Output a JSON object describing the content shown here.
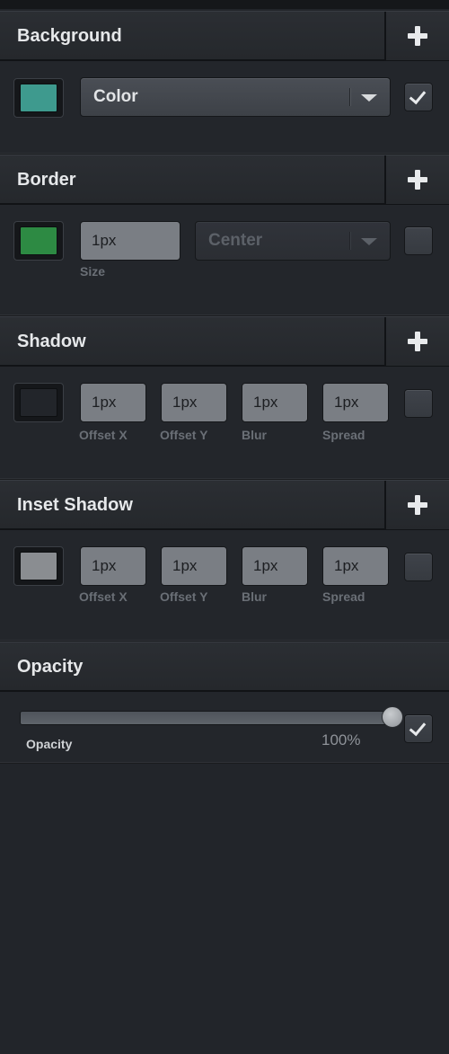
{
  "background": {
    "title": "Background",
    "swatch_color": "#3e9a8e",
    "dropdown_value": "Color",
    "enabled": true
  },
  "border": {
    "title": "Border",
    "swatch_color": "#2d8a43",
    "size_value": "1px",
    "size_label": "Size",
    "position_value": "Center",
    "enabled": false
  },
  "shadow": {
    "title": "Shadow",
    "swatch_color": "#22252a",
    "offset_x_value": "1px",
    "offset_y_value": "1px",
    "blur_value": "1px",
    "spread_value": "1px",
    "offset_x_label": "Offset X",
    "offset_y_label": "Offset Y",
    "blur_label": "Blur",
    "spread_label": "Spread",
    "enabled": false
  },
  "inset_shadow": {
    "title": "Inset Shadow",
    "swatch_color": "#8a8d91",
    "offset_x_value": "1px",
    "offset_y_value": "1px",
    "blur_value": "1px",
    "spread_value": "1px",
    "offset_x_label": "Offset X",
    "offset_y_label": "Offset Y",
    "blur_label": "Blur",
    "spread_label": "Spread",
    "enabled": false
  },
  "opacity": {
    "title": "Opacity",
    "label": "Opacity",
    "value_text": "100%",
    "value": 1.0,
    "enabled": true
  },
  "icons": {
    "add": "plus-icon",
    "dropdown": "chevron-down-icon",
    "check": "checkmark-icon"
  }
}
